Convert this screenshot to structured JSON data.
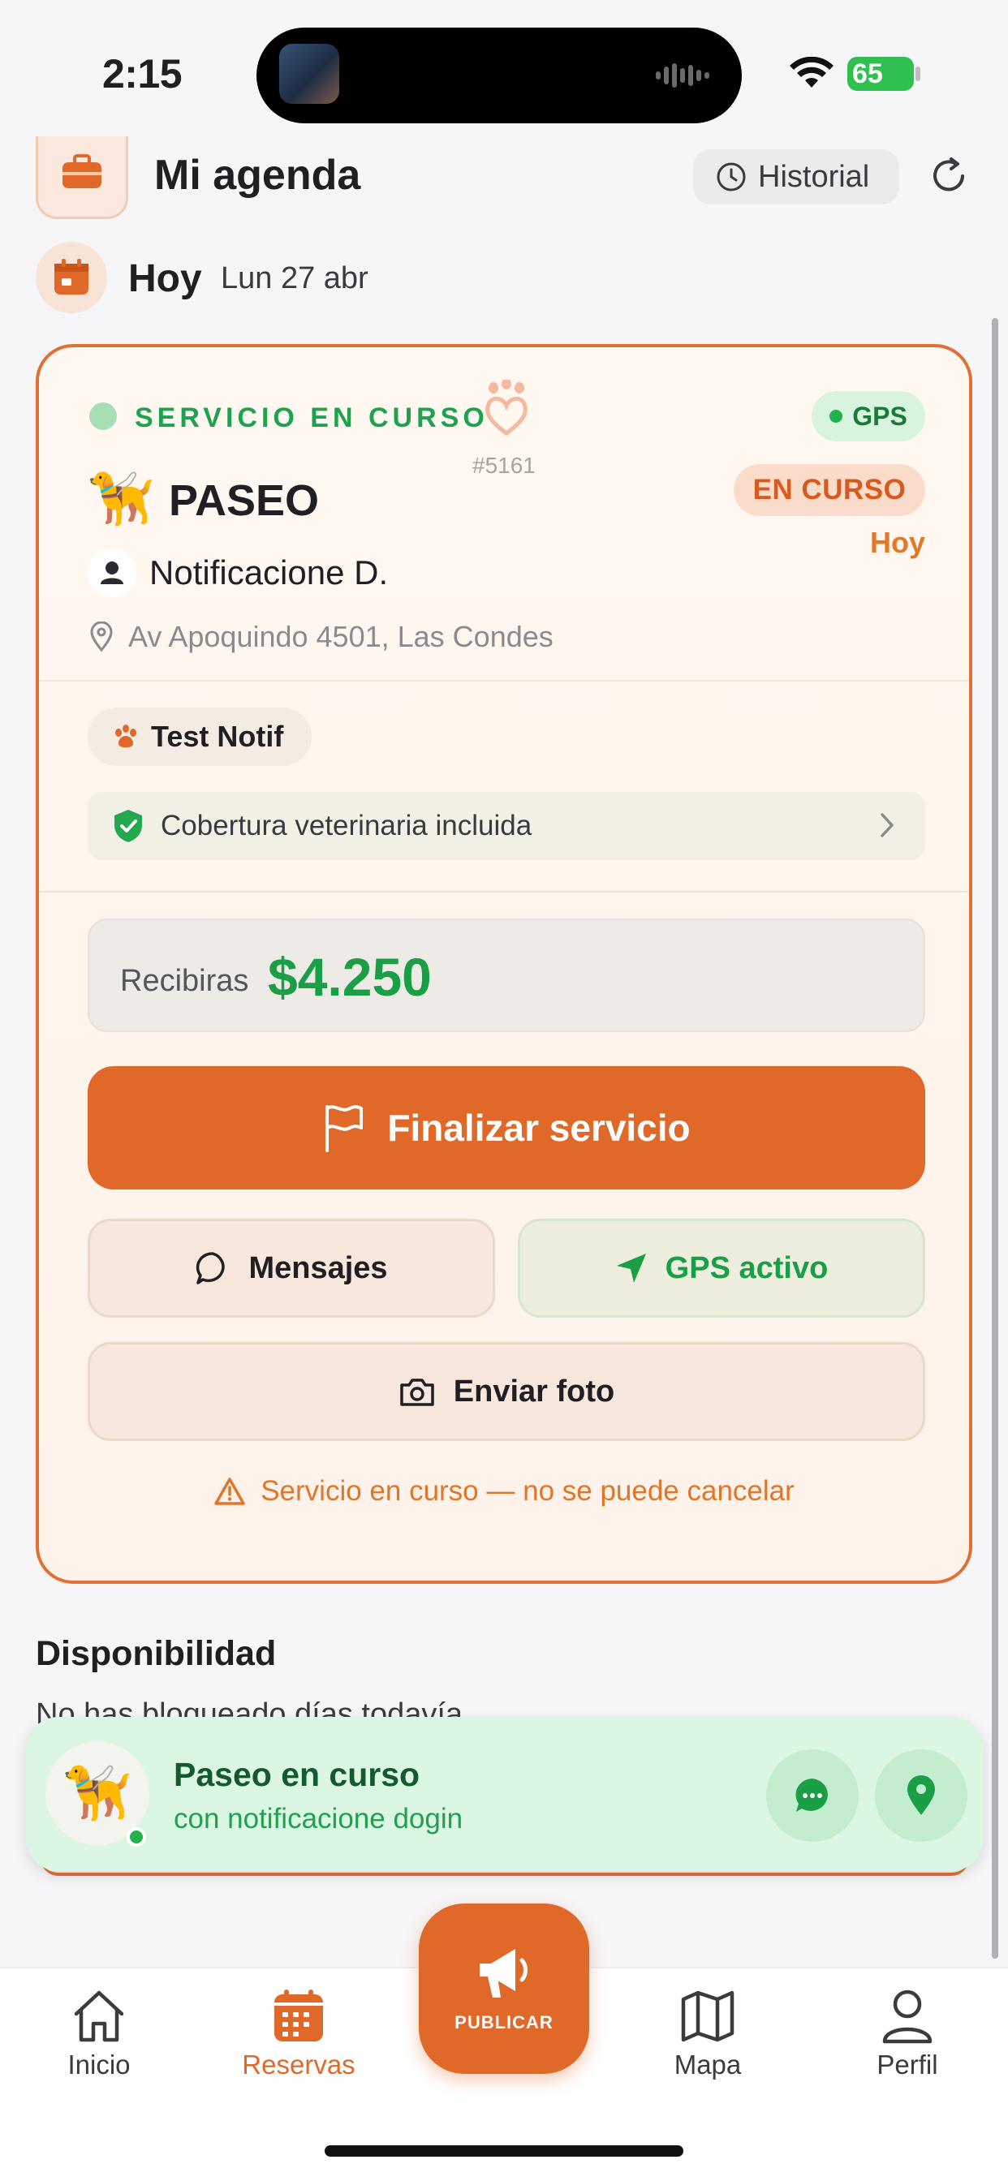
{
  "status_bar": {
    "time": "2:15",
    "battery": "65"
  },
  "header": {
    "title": "Mi agenda",
    "history_label": "Historial"
  },
  "today": {
    "label": "Hoy",
    "date": "Lun 27 abr"
  },
  "service_card": {
    "status_label": "SERVICIO EN CURSO",
    "gps_label": "GPS",
    "order_id": "#5161",
    "service_emoji": "🦮",
    "service_type": "PASEO",
    "status_badge": "EN CURSO",
    "day_tag": "Hoy",
    "client_name": "Notificacione D.",
    "address": "Av Apoquindo 4501, Las Condes",
    "pet_name": "Test Notif",
    "coverage_label": "Cobertura veterinaria incluida",
    "earnings_label": "Recibiras",
    "earnings_value": "$4.250",
    "finish_label": "Finalizar servicio",
    "messages_label": "Mensajes",
    "gps_active_label": "GPS activo",
    "photo_label": "Enviar foto",
    "warning": "Servicio en curso — no se puede cancelar"
  },
  "availability": {
    "title": "Disponibilidad",
    "subtitle": "No has bloqueado días todavía"
  },
  "banner": {
    "emoji": "🦮",
    "title": "Paseo en curso",
    "subtitle": "con notificacione dogin"
  },
  "tabbar": {
    "home": "Inicio",
    "bookings": "Reservas",
    "publish": "PUBLICAR",
    "map": "Mapa",
    "profile": "Perfil"
  },
  "colors": {
    "accent": "#e0692a",
    "success": "#1a9f47",
    "card_border": "#e07035"
  }
}
